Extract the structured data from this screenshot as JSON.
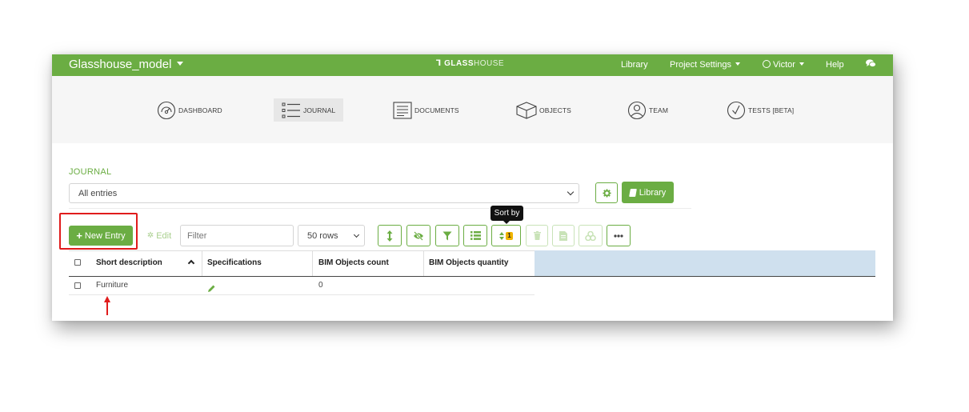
{
  "topbar": {
    "project_name": "Glasshouse_model",
    "brand": {
      "logo": "ꓶ",
      "part1": "GLASS",
      "part2": "HOUSE"
    },
    "links": {
      "library": "Library",
      "project_settings": "Project Settings",
      "user": "Victor",
      "help": "Help"
    }
  },
  "modules": [
    {
      "label": "DASHBOARD",
      "icon": "gauge-icon"
    },
    {
      "label": "JOURNAL",
      "icon": "list-icon",
      "active": true
    },
    {
      "label": "DOCUMENTS",
      "icon": "document-icon"
    },
    {
      "label": "OBJECTS",
      "icon": "cube-icon"
    },
    {
      "label": "TEAM",
      "icon": "user-icon"
    },
    {
      "label": "TESTS [BETA]",
      "icon": "check-circle-icon"
    }
  ],
  "journal": {
    "title": "JOURNAL",
    "entries_select": "All entries",
    "library_button": "Library"
  },
  "toolbar": {
    "new_entry": "New Entry",
    "edit": "Edit",
    "filter_placeholder": "Filter",
    "rows": "50 rows",
    "sort_count": "1",
    "tooltip": "Sort by",
    "buttons": [
      "resize-icon",
      "hide-icon",
      "filter-icon",
      "list-icon",
      "sort-icon",
      "trash-icon",
      "file-icon",
      "link-icon",
      "more-icon"
    ]
  },
  "table": {
    "columns": [
      "Short description",
      "Specifications",
      "BIM Objects count",
      "BIM Objects quantity"
    ],
    "rows": [
      {
        "short_description": "Furniture",
        "bim_count": "0"
      }
    ]
  },
  "colors": {
    "brand_green": "#6bad43",
    "highlight_red": "#e01b1b",
    "header_blue": "#cfe0ee",
    "badge_yellow": "#f0b400"
  }
}
